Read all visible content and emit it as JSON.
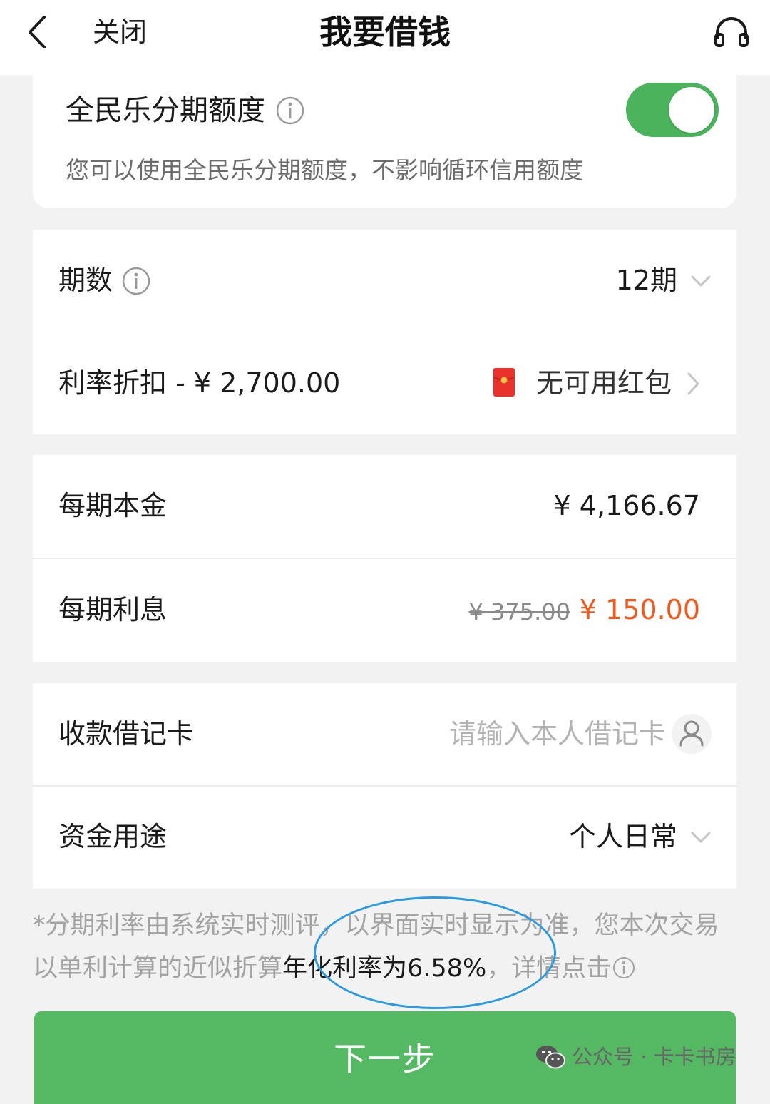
{
  "header": {
    "back_icon": "chevron-left-icon",
    "close_label": "关闭",
    "title": "我要借钱",
    "support_icon": "headset-icon"
  },
  "quota": {
    "title": "全民乐分期额度",
    "description": "您可以使用全民乐分期额度，不影响循环信用额度",
    "toggle_on": true,
    "toggle_color": "#4ab35c"
  },
  "term": {
    "label": "期数",
    "value": "12期"
  },
  "discount": {
    "label": "利率折扣 - ¥ 2,700.00",
    "coupon_label": "无可用红包",
    "coupon_icon": "red-envelope-icon"
  },
  "principal": {
    "label": "每期本金",
    "value": "¥ 4,166.67"
  },
  "interest": {
    "label": "每期利息",
    "original": "¥ 375.00",
    "discounted": "¥ 150.00",
    "discount_color": "#f05a1e"
  },
  "bank_card": {
    "label": "收款借记卡",
    "placeholder": "请输入本人借记卡"
  },
  "purpose": {
    "label": "资金用途",
    "value": "个人日常"
  },
  "disclaimer": {
    "text_before": "*分期利率由系统实时测评，以界面实时显示为准，您本次交易以单利计算的近似折算",
    "highlight": "年化利率为6.58%",
    "text_after": "，详情点击"
  },
  "next_button": {
    "label": "下一步",
    "color": "#55b964"
  },
  "watermark": {
    "icon": "wechat-icon",
    "text": "公众号 · 卡卡书房"
  }
}
